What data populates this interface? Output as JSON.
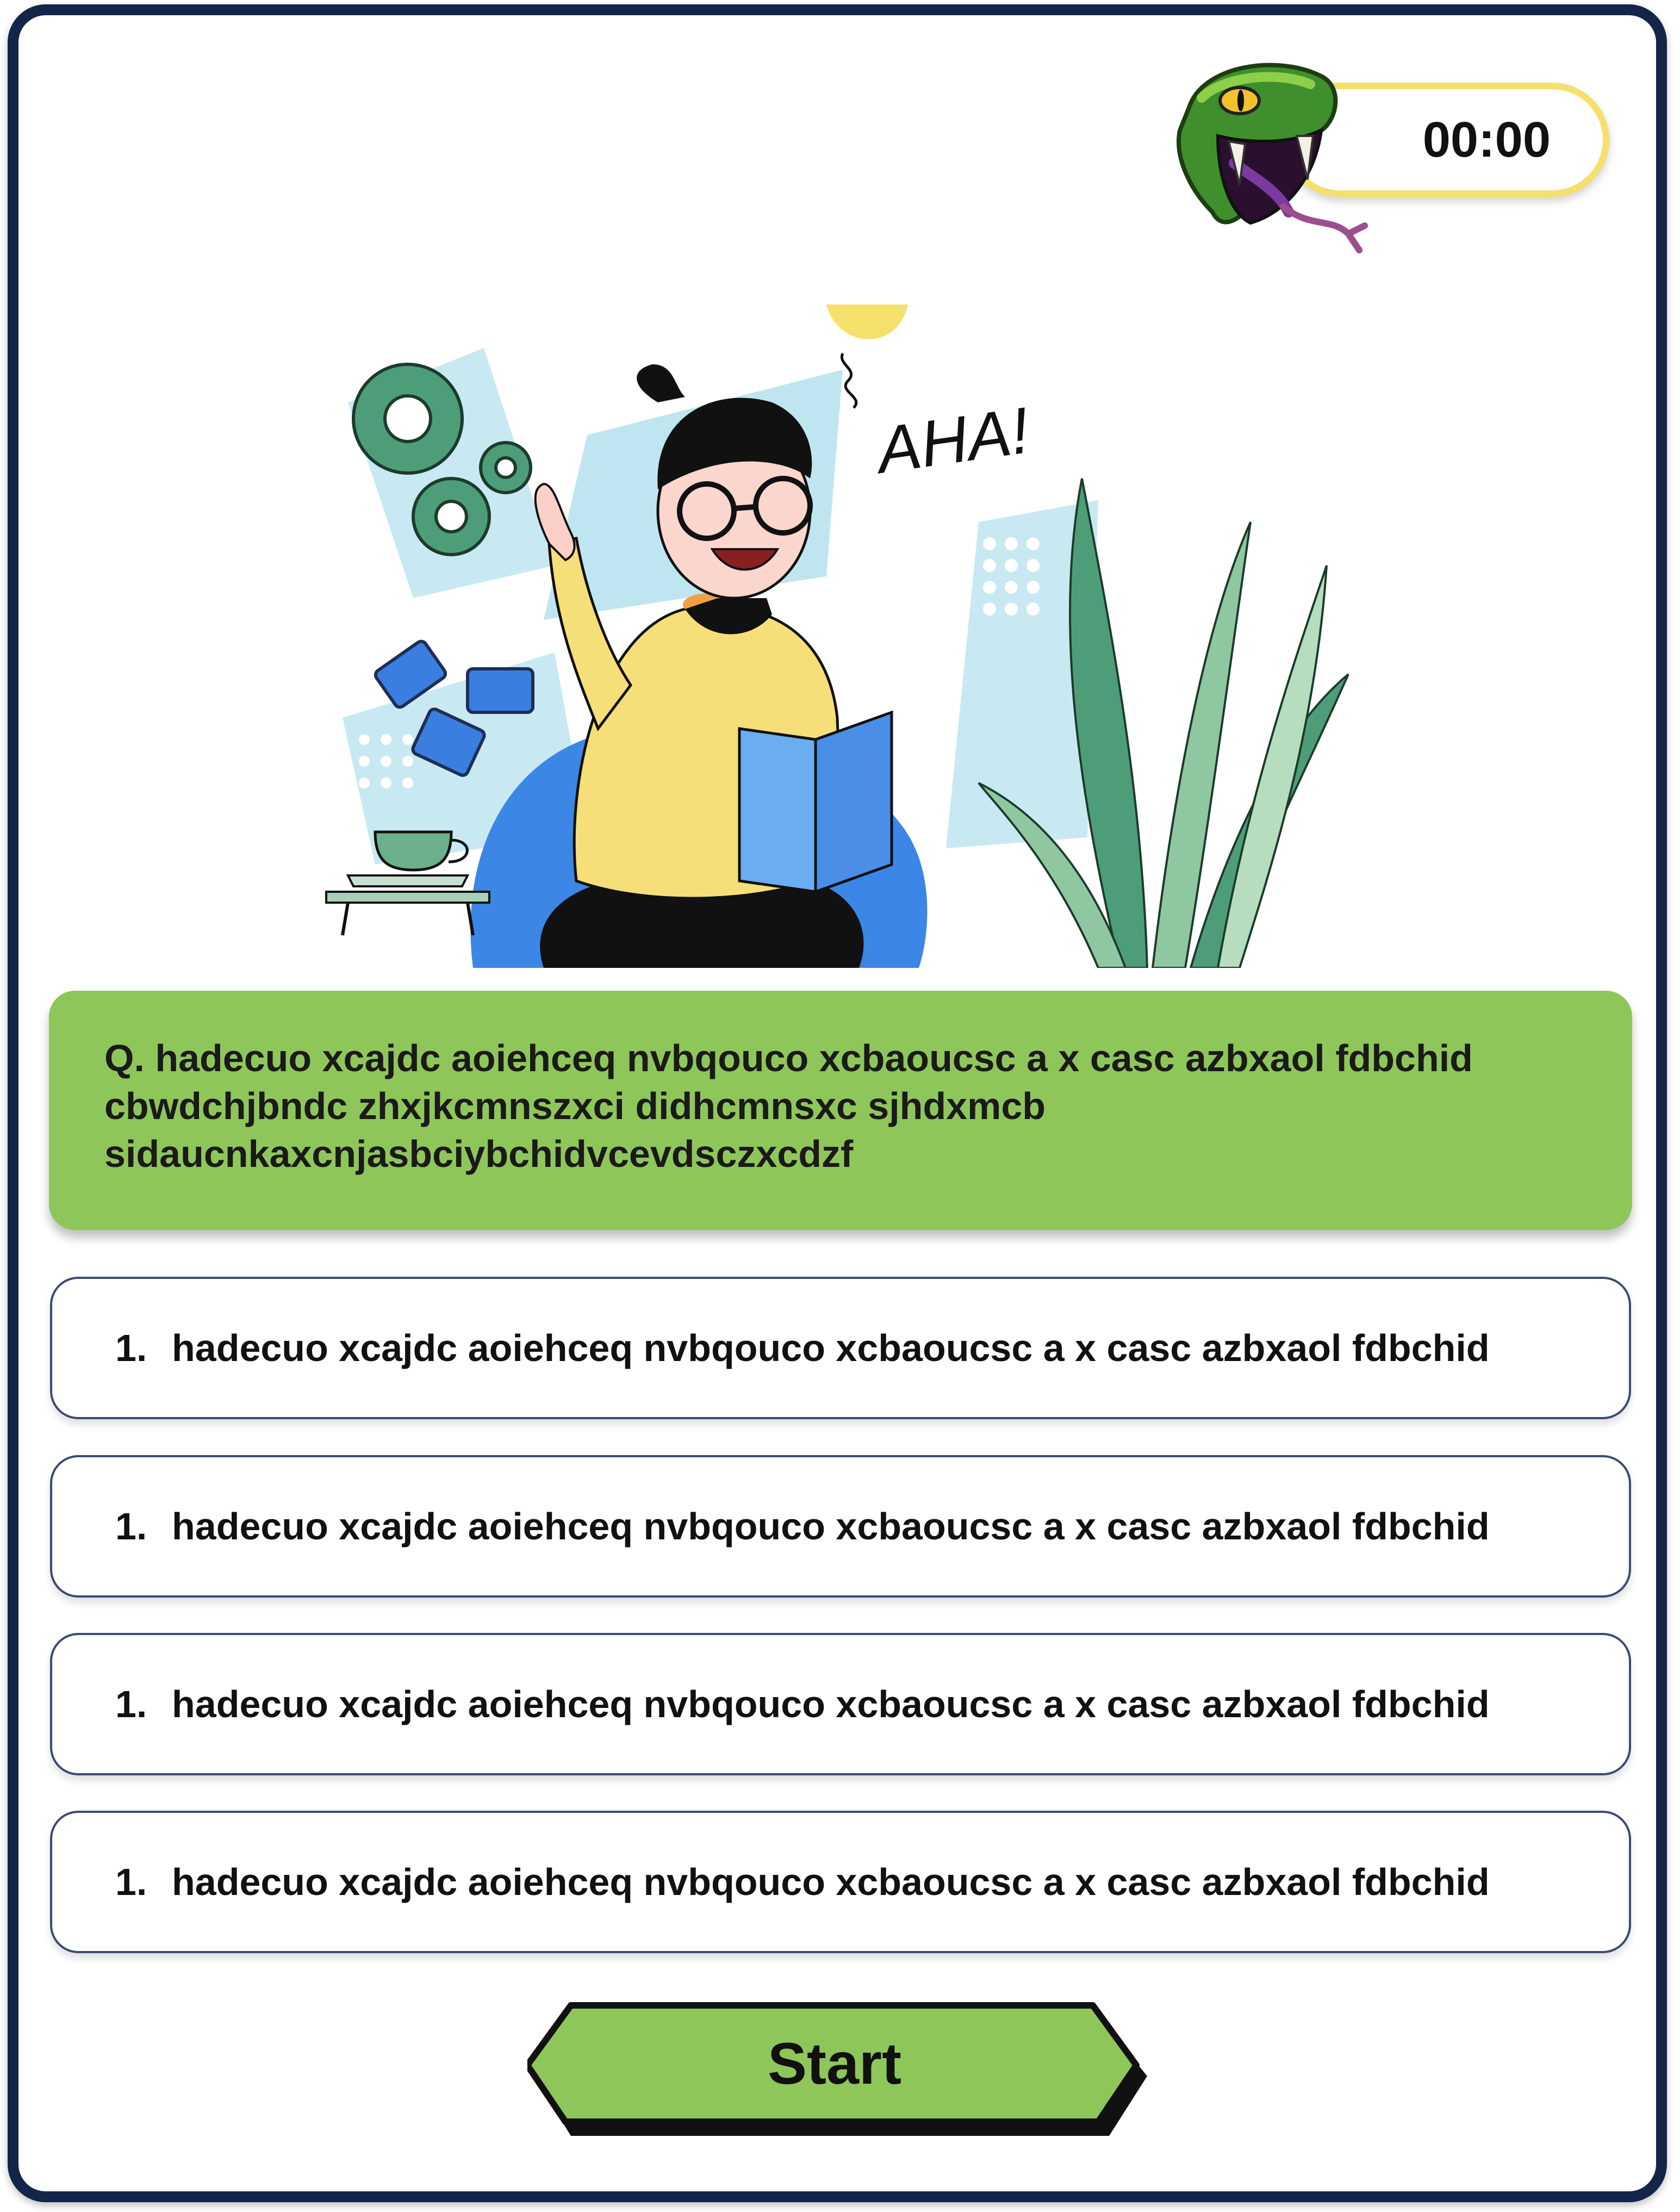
{
  "timer": {
    "value": "00:00"
  },
  "illustration": {
    "exclamation": "AHA!"
  },
  "question": {
    "text": "Q. hadecuo xcajdc aoiehceq nvbqouco xcbaoucsc a x casc azbxaol fdbchid cbwdchjbndc zhxjkcmnszxci didhcmnsxc sjhdxmcb sidaucnkaxcnjasbciybchidvcevdsczxcdzf"
  },
  "options": [
    {
      "number": "1.",
      "text": "hadecuo xcajdc aoiehceq nvbqouco xcbaoucsc a x casc azbxaol fdbchid"
    },
    {
      "number": "1.",
      "text": "hadecuo xcajdc aoiehceq nvbqouco xcbaoucsc a x casc azbxaol fdbchid"
    },
    {
      "number": "1.",
      "text": "hadecuo xcajdc aoiehceq nvbqouco xcbaoucsc a x casc azbxaol fdbchid"
    },
    {
      "number": "1.",
      "text": "hadecuo xcajdc aoiehceq nvbqouco xcbaoucsc a x casc azbxaol fdbchid"
    }
  ],
  "start_button": {
    "label": "Start"
  },
  "colors": {
    "frame": "#13264a",
    "question_bg": "#8fc65a",
    "timer_border": "#f5e06b",
    "button_bg": "#8fc65a"
  },
  "icons": [
    "snake-icon",
    "gear-icon",
    "puzzle-icon",
    "lightbulb-icon",
    "coffee-cup-icon",
    "plant-icon",
    "book-icon"
  ]
}
